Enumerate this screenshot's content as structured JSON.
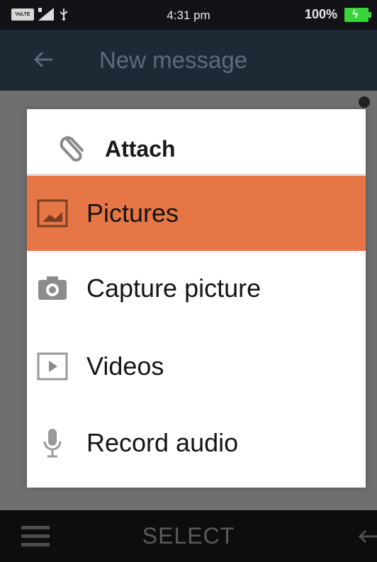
{
  "status_bar": {
    "sim_label": "VoLTE",
    "time": "4:31 pm",
    "battery_percent": "100%",
    "battery_level": 1.0,
    "icons": [
      "sim-icon",
      "signal-icon",
      "usb-icon",
      "battery-icon"
    ]
  },
  "header": {
    "title": "New message",
    "back_icon": "back-arrow-icon"
  },
  "dialog": {
    "title": "Attach",
    "title_icon": "paperclip-icon",
    "items": [
      {
        "label": "Pictures",
        "icon": "image-icon",
        "selected": true
      },
      {
        "label": "Capture picture",
        "icon": "camera-icon",
        "selected": false
      },
      {
        "label": "Videos",
        "icon": "video-icon",
        "selected": false
      },
      {
        "label": "Record audio",
        "icon": "microphone-icon",
        "selected": false
      }
    ]
  },
  "softkeys": {
    "left_icon": "menu-icon",
    "center": "SELECT",
    "right_icon": "back-arrow-icon"
  },
  "colors": {
    "highlight": "#e67646",
    "header_bg": "#1e2936",
    "dim_bg": "#6f6f6f",
    "battery": "#3bd33b"
  }
}
